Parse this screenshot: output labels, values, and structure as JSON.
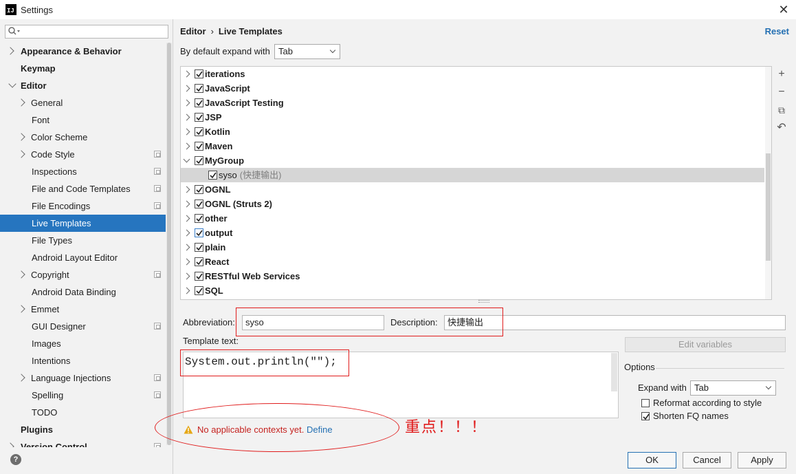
{
  "window": {
    "title": "Settings",
    "app_icon_text": "IJ",
    "close_glyph": "✕"
  },
  "sidebar": {
    "search_placeholder": "",
    "items": [
      {
        "label": "Appearance & Behavior",
        "level": 0,
        "bold": true,
        "chevron": "closed"
      },
      {
        "label": "Keymap",
        "level": 0,
        "bold": true,
        "chevron": "none"
      },
      {
        "label": "Editor",
        "level": 0,
        "bold": true,
        "chevron": "open"
      },
      {
        "label": "General",
        "level": 1,
        "bold": false,
        "chevron": "closed"
      },
      {
        "label": "Font",
        "level": 1,
        "bold": false,
        "chevron": "none"
      },
      {
        "label": "Color Scheme",
        "level": 1,
        "bold": false,
        "chevron": "closed"
      },
      {
        "label": "Code Style",
        "level": 1,
        "bold": false,
        "chevron": "closed",
        "copy_icon": true
      },
      {
        "label": "Inspections",
        "level": 1,
        "bold": false,
        "chevron": "none",
        "copy_icon": true
      },
      {
        "label": "File and Code Templates",
        "level": 1,
        "bold": false,
        "chevron": "none",
        "copy_icon": true
      },
      {
        "label": "File Encodings",
        "level": 1,
        "bold": false,
        "chevron": "none",
        "copy_icon": true
      },
      {
        "label": "Live Templates",
        "level": 1,
        "bold": false,
        "chevron": "none",
        "selected": true
      },
      {
        "label": "File Types",
        "level": 1,
        "bold": false,
        "chevron": "none"
      },
      {
        "label": "Android Layout Editor",
        "level": 1,
        "bold": false,
        "chevron": "none"
      },
      {
        "label": "Copyright",
        "level": 1,
        "bold": false,
        "chevron": "closed",
        "copy_icon": true
      },
      {
        "label": "Android Data Binding",
        "level": 1,
        "bold": false,
        "chevron": "none"
      },
      {
        "label": "Emmet",
        "level": 1,
        "bold": false,
        "chevron": "closed"
      },
      {
        "label": "GUI Designer",
        "level": 1,
        "bold": false,
        "chevron": "none",
        "copy_icon": true
      },
      {
        "label": "Images",
        "level": 1,
        "bold": false,
        "chevron": "none"
      },
      {
        "label": "Intentions",
        "level": 1,
        "bold": false,
        "chevron": "none"
      },
      {
        "label": "Language Injections",
        "level": 1,
        "bold": false,
        "chevron": "closed",
        "copy_icon": true
      },
      {
        "label": "Spelling",
        "level": 1,
        "bold": false,
        "chevron": "none",
        "copy_icon": true
      },
      {
        "label": "TODO",
        "level": 1,
        "bold": false,
        "chevron": "none"
      },
      {
        "label": "Plugins",
        "level": 0,
        "bold": true,
        "chevron": "none"
      },
      {
        "label": "Version Control",
        "level": 0,
        "bold": true,
        "chevron": "closed",
        "copy_icon": true
      }
    ],
    "help_label": "?"
  },
  "header": {
    "breadcrumb": [
      "Editor",
      "Live Templates"
    ],
    "breadcrumb_sep": "›",
    "reset_label": "Reset",
    "expand_label": "By default expand with",
    "expand_value": "Tab"
  },
  "templates": [
    {
      "name": "iterations",
      "checked": true,
      "expanded": false
    },
    {
      "name": "JavaScript",
      "checked": true,
      "expanded": false
    },
    {
      "name": "JavaScript Testing",
      "checked": true,
      "expanded": false
    },
    {
      "name": "JSP",
      "checked": true,
      "expanded": false
    },
    {
      "name": "Kotlin",
      "checked": true,
      "expanded": false
    },
    {
      "name": "Maven",
      "checked": true,
      "expanded": false
    },
    {
      "name": "MyGroup",
      "checked": true,
      "expanded": true
    },
    {
      "name": "syso",
      "description": "(快捷输出)",
      "checked": true,
      "child": true
    },
    {
      "name": "OGNL",
      "checked": true,
      "expanded": false
    },
    {
      "name": "OGNL (Struts 2)",
      "checked": true,
      "expanded": false
    },
    {
      "name": "other",
      "checked": true,
      "expanded": false
    },
    {
      "name": "output",
      "checked": true,
      "expanded": false,
      "blue": true
    },
    {
      "name": "plain",
      "checked": true,
      "expanded": false
    },
    {
      "name": "React",
      "checked": true,
      "expanded": false
    },
    {
      "name": "RESTful Web Services",
      "checked": true,
      "expanded": false
    },
    {
      "name": "SQL",
      "checked": true,
      "expanded": false
    }
  ],
  "tools": {
    "add": "+",
    "remove": "−",
    "copy": "⧉",
    "restore": "↶"
  },
  "editor": {
    "abbreviation_label": "Abbreviation:",
    "abbreviation_value": "syso",
    "description_label": "Description:",
    "description_value": "快捷输出",
    "edit_variables_label": "Edit variables",
    "template_text_label": "Template text:",
    "template_text": "System.out.println(\"\");"
  },
  "options": {
    "title": "Options",
    "expand_with_label": "Expand with",
    "expand_with_value": "Tab",
    "reformat_label": "Reformat according to style",
    "reformat_checked": false,
    "shorten_label": "Shorten FQ names",
    "shorten_checked": true
  },
  "warning": {
    "text": "No applicable contexts yet.",
    "link": "Define"
  },
  "annotation": {
    "text": "重点！！！",
    "color": "#e01b1b"
  },
  "footer": {
    "ok": "OK",
    "cancel": "Cancel",
    "apply": "Apply"
  },
  "colors": {
    "selection": "#2675bf",
    "link": "#2470b3",
    "warning": "#c5221f",
    "accent_border": "#e01b1b"
  }
}
